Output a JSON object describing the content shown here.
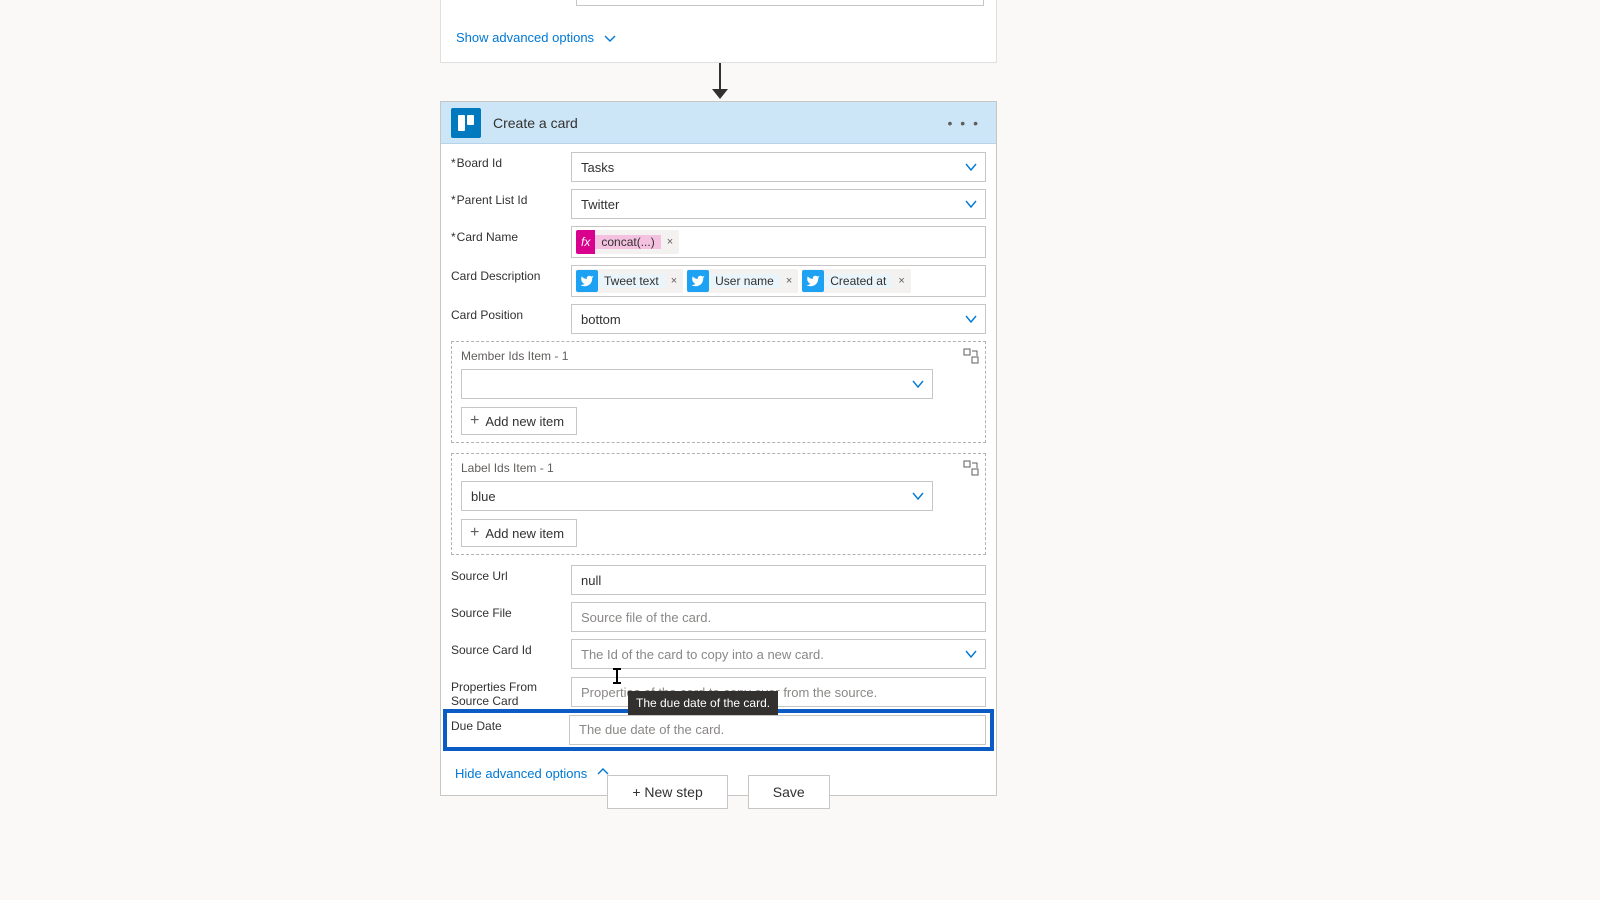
{
  "prev_card": {
    "show_advanced": "Show advanced options"
  },
  "header": {
    "title": "Create a card"
  },
  "fields": {
    "board_id": {
      "label": "Board Id",
      "value": "Tasks"
    },
    "parent_list_id": {
      "label": "Parent List Id",
      "value": "Twitter"
    },
    "card_name": {
      "label": "Card Name",
      "token_fx": "fx",
      "token_label": "concat(...)"
    },
    "card_description": {
      "label": "Card Description",
      "tokens": [
        {
          "label": "Tweet text"
        },
        {
          "label": "User name"
        },
        {
          "label": "Created at"
        }
      ]
    },
    "card_position": {
      "label": "Card Position",
      "value": "bottom"
    },
    "member_ids": {
      "label": "Member Ids Item - 1",
      "add_btn": "Add new item"
    },
    "label_ids": {
      "label": "Label Ids Item - 1",
      "value": "blue",
      "add_btn": "Add new item"
    },
    "source_url": {
      "label": "Source Url",
      "value": "null"
    },
    "source_file": {
      "label": "Source File",
      "placeholder": "Source file of the card."
    },
    "source_card_id": {
      "label": "Source Card Id",
      "placeholder": "The Id of the card to copy into a new card."
    },
    "props_from_source": {
      "label": "Properties From Source Card",
      "placeholder": "Properties of the card to copy over from the source."
    },
    "due_date": {
      "label": "Due Date",
      "placeholder": "The due date of the card."
    }
  },
  "hide_advanced": "Hide advanced options",
  "tooltip": "The due date of the card.",
  "footer": {
    "new_step": "+ New step",
    "save": "Save"
  }
}
